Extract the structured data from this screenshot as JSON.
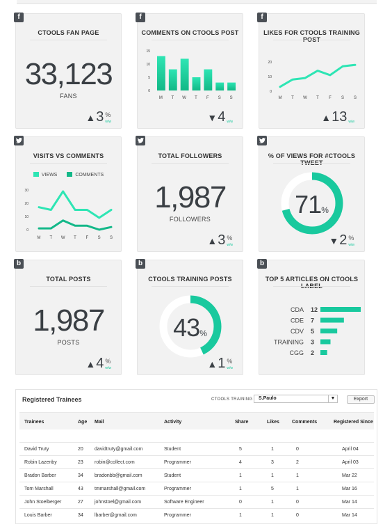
{
  "cards": {
    "fan_page": {
      "title": "CTOOLS FAN PAGE",
      "value": "33,123",
      "sub": "FANS",
      "delta": "3",
      "pct": "%",
      "ww": "w/w",
      "dir": "up",
      "badge": "f"
    },
    "comments": {
      "title": "COMMENTS ON CTOOLS POST",
      "delta": "4",
      "ww": "w/w",
      "dir": "down",
      "badge": "f",
      "chart_data": {
        "type": "bar",
        "categories": [
          "M",
          "T",
          "W",
          "T",
          "F",
          "S",
          "S"
        ],
        "values": [
          13,
          8,
          12,
          5,
          8,
          3,
          3
        ],
        "yticks": [
          "15",
          "10",
          "5",
          "0"
        ],
        "ylim": [
          0,
          15
        ]
      }
    },
    "likes": {
      "title": "LIKES FOR CTOOLS TRAINING POST",
      "delta": "13",
      "ww": "w/w",
      "dir": "up",
      "badge": "f",
      "chart_data": {
        "type": "line",
        "categories": [
          "M",
          "T",
          "W",
          "T",
          "F",
          "S",
          "S"
        ],
        "values": [
          3,
          8,
          9,
          14,
          11,
          17,
          18
        ],
        "yticks": [
          "20",
          "10",
          "0"
        ],
        "ylim": [
          0,
          20
        ]
      }
    },
    "visits": {
      "title": "VISITS VS COMMENTS",
      "badge": "t",
      "legend": [
        "VIEWS",
        "COMMENTS"
      ],
      "chart_data": {
        "type": "line",
        "categories": [
          "M",
          "T",
          "W",
          "T",
          "F",
          "S",
          "S"
        ],
        "series": [
          {
            "name": "VIEWS",
            "values": [
              17,
              15,
              29,
              15,
              15,
              9,
              15
            ]
          },
          {
            "name": "COMMENTS",
            "values": [
              1,
              1,
              7,
              3,
              3,
              0,
              2
            ]
          }
        ],
        "yticks": [
          "30",
          "20",
          "10",
          "0"
        ],
        "ylim": [
          0,
          30
        ]
      }
    },
    "followers": {
      "title": "TOTAL FOLLOWERS",
      "value": "1,987",
      "sub": "FOLLOWERS",
      "delta": "3",
      "pct": "%",
      "ww": "w/w",
      "dir": "up",
      "badge": "t"
    },
    "views_pct": {
      "title": "% OF VIEWS FOR #CTOOLS TWEET",
      "value": "71",
      "pct_sign": "%",
      "fraction": 0.71,
      "delta": "2",
      "pct": "%",
      "ww": "w/w",
      "dir": "down",
      "badge": "t"
    },
    "total_posts": {
      "title": "TOTAL POSTS",
      "value": "1,987",
      "sub": "POSTS",
      "delta": "4",
      "pct": "%",
      "ww": "w/w",
      "dir": "up",
      "badge": "b"
    },
    "training_posts": {
      "title": "CTOOLS TRAINING POSTS",
      "value": "43",
      "pct_sign": "%",
      "fraction": 0.43,
      "delta": "1",
      "pct": "%",
      "ww": "w/w",
      "dir": "up",
      "badge": "b"
    },
    "top5": {
      "title": "TOP 5 ARTICLES ON CTOOLS LABEL",
      "badge": "b",
      "chart_data": {
        "type": "bar",
        "categories": [
          "CDA",
          "CDE",
          "CDV",
          "TRAINING",
          "CGG"
        ],
        "values": [
          12,
          7,
          5,
          3,
          2
        ]
      }
    }
  },
  "colors": {
    "accent": "#19c99e",
    "card_bg": "#f2f2f2",
    "donut_track": "#ffffff"
  },
  "trainees": {
    "title": "Registered Trainees",
    "filter_label": "CTOOLS TRAINING",
    "filter_value": "S.Paulo",
    "export_label": "Export",
    "columns": [
      "Trainees",
      "Age",
      "Mail",
      "Activity",
      "Share",
      "Likes",
      "Comments",
      "Registered Since"
    ],
    "rows": [
      [
        "David Truty",
        "20",
        "davidtruty@gmail.com",
        "Student",
        "5",
        "1",
        "0",
        "April 04"
      ],
      [
        "Robin Lazenby",
        "23",
        "robin@collect.com",
        "Programmer",
        "4",
        "3",
        "2",
        "April 03"
      ],
      [
        "Bradon Barber",
        "34",
        "bradonbb@gmail.com",
        "Student",
        "1",
        "1",
        "1",
        "Mar 22"
      ],
      [
        "Tom Marshall",
        "43",
        "tmmarshall@gmail.com",
        "Programmer",
        "1",
        "5",
        "1",
        "Mar 16"
      ],
      [
        "John Stoelberger",
        "27",
        "johnstoel@gmail.com",
        "Software Engineer",
        "0",
        "1",
        "0",
        "Mar 14"
      ],
      [
        "Louis Barber",
        "34",
        "lbarber@gmail.com",
        "Programmer",
        "1",
        "1",
        "0",
        "Mar 14"
      ]
    ]
  }
}
